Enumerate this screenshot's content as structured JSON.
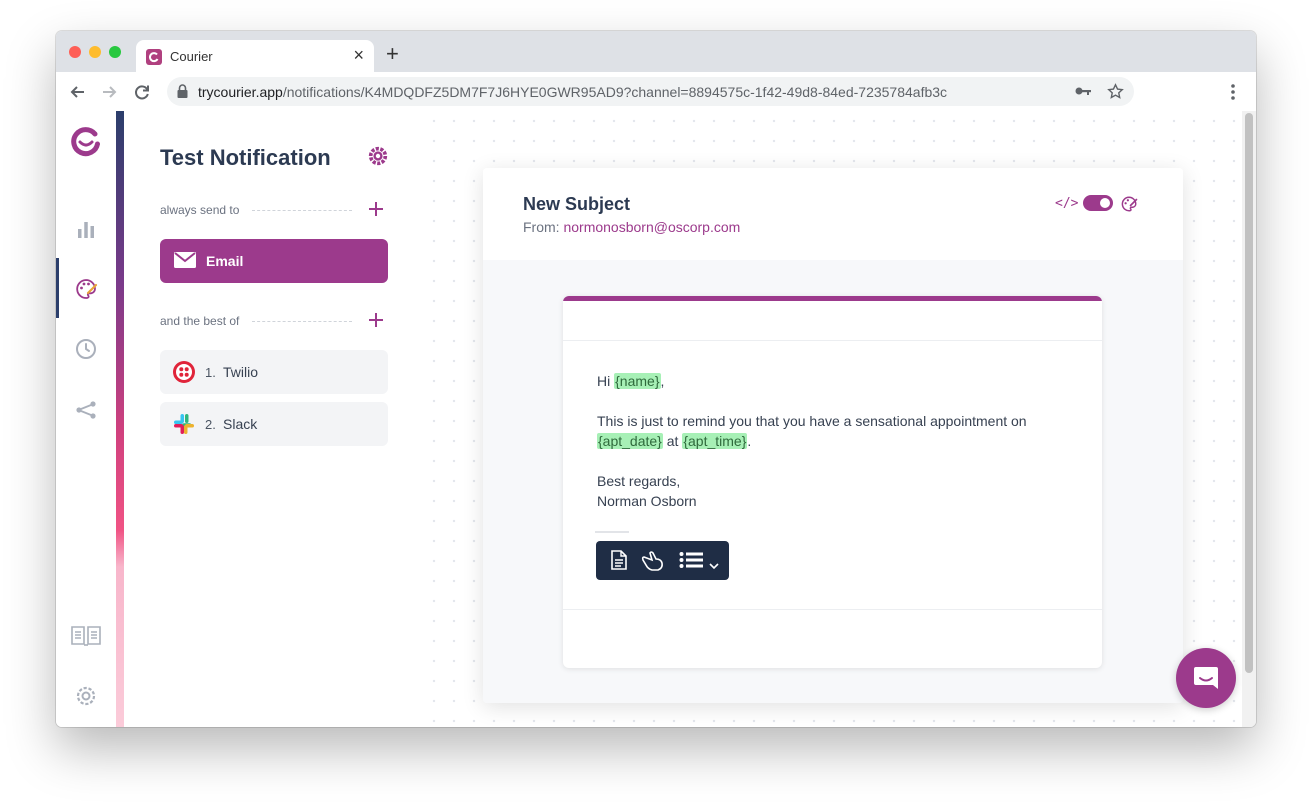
{
  "browser": {
    "tab_title": "Courier",
    "url_domain": "trycourier.app",
    "url_path": "/notifications/K4MDQDFZ5DM7F7J6HYE0GWR95AD9?channel=8894575c-1f42-49d8-84ed-7235784afb3c"
  },
  "panel": {
    "title": "Test Notification",
    "always_send_label": "always send to",
    "email_label": "Email",
    "best_of_label": "and the best of",
    "providers": [
      {
        "num": "1.",
        "name": "Twilio"
      },
      {
        "num": "2.",
        "name": "Slack"
      }
    ]
  },
  "editor": {
    "subject": "New Subject",
    "from_label": "From:",
    "from_address": "normonosborn@oscorp.com",
    "code_icon_text": "</>"
  },
  "template": {
    "greeting": "Hi",
    "name_var": "{name}",
    "comma": ",",
    "body_line1": "This is just to remind you that you have a sensational appointment on",
    "date_var": "{apt_date}",
    "at_text": "at",
    "time_var": "{apt_time}",
    "period": ".",
    "signoff1": "Best regards,",
    "signoff2": "Norman Osborn"
  },
  "colors": {
    "brand": "#9c3a8c",
    "navy": "#2c3a52",
    "variable_highlight": "#a7f0b6"
  },
  "icons": {
    "rail": [
      "courier-logo-icon",
      "bar-chart-icon",
      "palette-icon",
      "clock-icon",
      "share-icon",
      "book-icon",
      "settings-icon"
    ],
    "block_toolbar": [
      "document-icon",
      "hand-pointer-icon",
      "list-icon",
      "chevron-down-icon"
    ]
  }
}
